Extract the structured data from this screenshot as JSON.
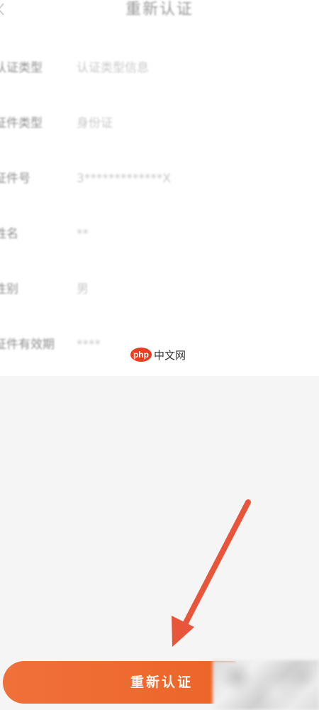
{
  "header": {
    "title": "重新认证",
    "back_icon": "chevron-left-icon"
  },
  "info": {
    "rows": [
      {
        "label": "认证类型",
        "value": "认证类型信息"
      },
      {
        "label": "证件类型",
        "value": "身份证"
      },
      {
        "label": "证件号",
        "value": "3*************X"
      },
      {
        "label": "姓名",
        "value": "**"
      },
      {
        "label": "性别",
        "value": "男"
      },
      {
        "label": "证件有效期",
        "value": "****"
      }
    ]
  },
  "watermark": {
    "logo_text": "php",
    "text": "中文网",
    "logo_color": "#e93d1f"
  },
  "annotation": {
    "arrow_color": "#e8553a"
  },
  "action": {
    "reauth_label": "重新认证",
    "button_color": "#ee6a30"
  }
}
